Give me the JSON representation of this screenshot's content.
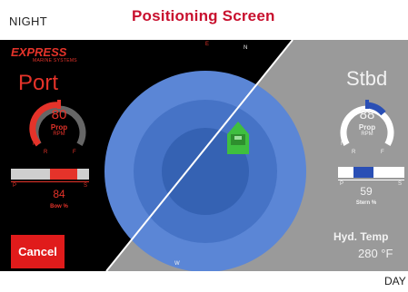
{
  "labels": {
    "night": "NIGHT",
    "title": "Positioning Screen",
    "day": "DAY"
  },
  "night": {
    "brand": "EXPRESS",
    "brand_sub": "MARINE SYSTEMS",
    "port_label": "Port",
    "rpm_value": "80",
    "rpm_label": "Prop",
    "rpm_unit": "RPM",
    "gauge_ticks": [
      "N",
      "R",
      "F"
    ],
    "slider_value": "84",
    "slider_label": "Bow %",
    "slider_ticks": [
      "P",
      "S"
    ],
    "cancel_label": "Cancel"
  },
  "day": {
    "stbd_label": "Stbd",
    "rpm_value": "88",
    "rpm_label": "Prop",
    "rpm_unit": "RPM",
    "gauge_ticks": [
      "N",
      "R",
      "F"
    ],
    "slider_value": "59",
    "slider_label": "Stern %",
    "slider_ticks": [
      "P",
      "S"
    ],
    "hyd_label": "Hyd. Temp",
    "hyd_value": "280 °F"
  },
  "compass": {
    "markers": [
      "E",
      "N",
      "W"
    ]
  },
  "colors": {
    "night_bg": "#000000",
    "night_accent": "#e5332a",
    "day_bg": "#9a9a9a",
    "day_accent": "#2a4fb5",
    "radar_outer": "#5b86d6",
    "radar_mid": "#4673c6",
    "radar_inner": "#3562b3",
    "vessel": "#3fbf3f",
    "title": "#c8102e"
  },
  "icons": {
    "vessel": "boat-icon"
  }
}
